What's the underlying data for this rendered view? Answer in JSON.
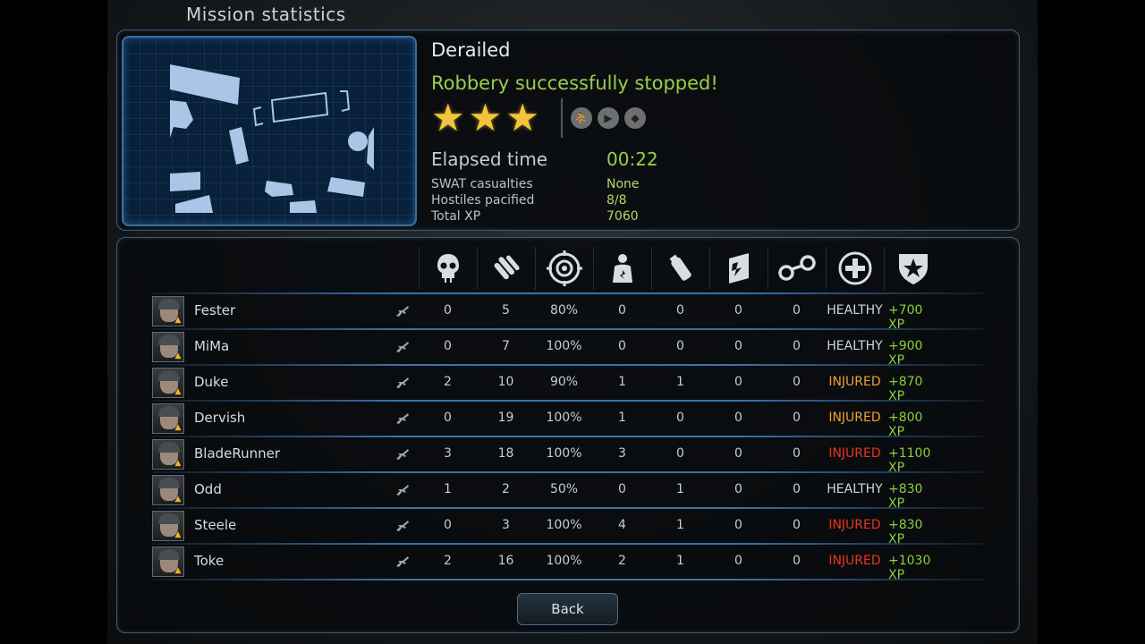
{
  "header": {
    "title": "Mission statistics"
  },
  "mission": {
    "name": "Derailed",
    "result": "Robbery successfully stopped!",
    "stars_earned": 3,
    "stars_total": 3,
    "bonus_icons": [
      "runner-icon",
      "play-icon",
      "shield-icon"
    ]
  },
  "summary": {
    "elapsed_label": "Elapsed time",
    "elapsed_value": "00:22",
    "casualties_label": "SWAT casualties",
    "casualties_value": "None",
    "hostiles_label": "Hostiles pacified",
    "hostiles_value": "8/8",
    "xp_label": "Total XP",
    "xp_value": "7060"
  },
  "columns": [
    {
      "icon": "skull-icon"
    },
    {
      "icon": "bullets-icon"
    },
    {
      "icon": "target-icon"
    },
    {
      "icon": "hit-person-icon"
    },
    {
      "icon": "grenade-icon"
    },
    {
      "icon": "door-breach-icon"
    },
    {
      "icon": "handcuffs-icon"
    },
    {
      "icon": "medical-cross-icon"
    },
    {
      "icon": "star-shield-icon"
    }
  ],
  "players": [
    {
      "name": "Fester",
      "kills": "0",
      "shots": "5",
      "accuracy": "80%",
      "hits": "0",
      "grenades": "0",
      "breaches": "0",
      "arrests": "0",
      "status": "HEALTHY",
      "status_color": "#cfd6da",
      "xp": "+700 XP"
    },
    {
      "name": "MiMa",
      "kills": "0",
      "shots": "7",
      "accuracy": "100%",
      "hits": "0",
      "grenades": "0",
      "breaches": "0",
      "arrests": "0",
      "status": "HEALTHY",
      "status_color": "#cfd6da",
      "xp": "+900 XP"
    },
    {
      "name": "Duke",
      "kills": "2",
      "shots": "10",
      "accuracy": "90%",
      "hits": "1",
      "grenades": "1",
      "breaches": "0",
      "arrests": "0",
      "status": "INJURED",
      "status_color": "#f0a030",
      "xp": "+870 XP"
    },
    {
      "name": "Dervish",
      "kills": "0",
      "shots": "19",
      "accuracy": "100%",
      "hits": "1",
      "grenades": "0",
      "breaches": "0",
      "arrests": "0",
      "status": "INJURED",
      "status_color": "#f0a030",
      "xp": "+800 XP"
    },
    {
      "name": "BladeRunner",
      "kills": "3",
      "shots": "18",
      "accuracy": "100%",
      "hits": "3",
      "grenades": "0",
      "breaches": "0",
      "arrests": "0",
      "status": "INJURED",
      "status_color": "#e8341e",
      "xp": "+1100 XP"
    },
    {
      "name": "Odd",
      "kills": "1",
      "shots": "2",
      "accuracy": "50%",
      "hits": "0",
      "grenades": "1",
      "breaches": "0",
      "arrests": "0",
      "status": "HEALTHY",
      "status_color": "#cfd6da",
      "xp": "+830 XP"
    },
    {
      "name": "Steele",
      "kills": "0",
      "shots": "3",
      "accuracy": "100%",
      "hits": "4",
      "grenades": "1",
      "breaches": "0",
      "arrests": "0",
      "status": "INJURED",
      "status_color": "#e8341e",
      "xp": "+830 XP"
    },
    {
      "name": "Toke",
      "kills": "2",
      "shots": "16",
      "accuracy": "100%",
      "hits": "2",
      "grenades": "1",
      "breaches": "0",
      "arrests": "0",
      "status": "INJURED",
      "status_color": "#e8341e",
      "xp": "+1030 XP"
    }
  ],
  "footer": {
    "back_label": "Back"
  }
}
